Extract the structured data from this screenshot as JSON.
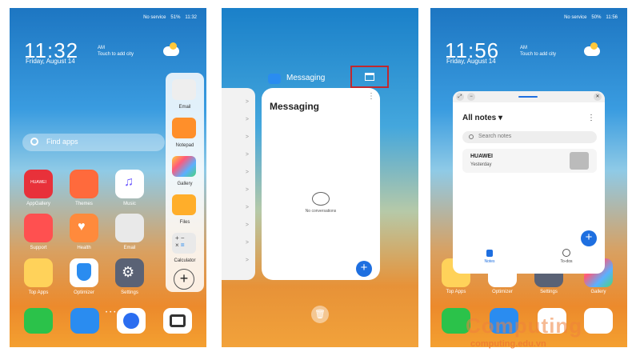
{
  "status_left": {
    "service": "No service",
    "battery": "51%",
    "time": "11:32"
  },
  "status_right": {
    "service": "No service",
    "battery": "50%",
    "time": "11:56"
  },
  "clock_left": {
    "time": "11:32",
    "ampm": "AM",
    "hint": "Touch to add city",
    "date": "Friday, August 14"
  },
  "clock_right": {
    "time": "11:56",
    "ampm": "AM",
    "hint": "Touch to add city",
    "date": "Friday, August 14"
  },
  "search": {
    "placeholder": "Find apps"
  },
  "home_apps": [
    {
      "label": "AppGallery",
      "color": "#e8313a",
      "badge": "HUAWEI"
    },
    {
      "label": "Themes",
      "color": "#ff6a3c"
    },
    {
      "label": "Music",
      "color": "#ffffff"
    },
    {
      "label": "Support",
      "color": "#ff5050"
    },
    {
      "label": "Health",
      "color": "#ff8a3c"
    },
    {
      "label": "Email",
      "color": "#e9e9e9"
    },
    {
      "label": "Top Apps",
      "color": "#ffd25a"
    },
    {
      "label": "Optimizer",
      "color": "#ffffff"
    },
    {
      "label": "Settings",
      "color": "#5a6275"
    }
  ],
  "side_drawer": [
    {
      "label": "Email"
    },
    {
      "label": "Notepad"
    },
    {
      "label": "Gallery"
    },
    {
      "label": "Files"
    },
    {
      "label": "Calculator"
    }
  ],
  "recents": {
    "app_label": "Messaging",
    "card_title": "Messaging",
    "empty": "No conversations",
    "side_arrows": [
      ">",
      ">",
      ">",
      ">",
      ">",
      ">",
      ">",
      ">",
      ">",
      ">"
    ]
  },
  "notes": {
    "title": "All notes ▾",
    "search_placeholder": "Search notes",
    "item_title": "HUAWEI",
    "item_date": "Yesterday",
    "tab_notes": "Notes",
    "tab_todos": "To-dos"
  },
  "right_home_labels": [
    "Top Apps",
    "Optimizer",
    "Settings",
    "Gallery"
  ],
  "watermark": {
    "brand": "Computing",
    "url": "computing.edu.vn"
  },
  "colors": {
    "accent": "#1e6fe0",
    "highlight": "#c0282e"
  }
}
